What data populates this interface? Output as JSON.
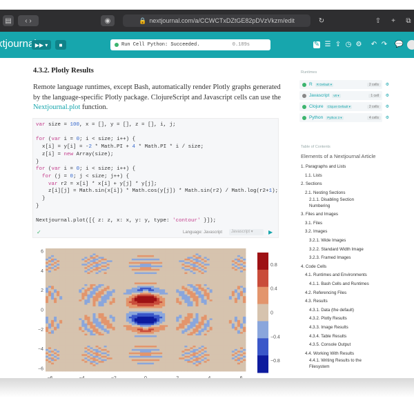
{
  "browser": {
    "url": "nextjournal.com/a/CCWCTxDZtGE82pDVzVkzm/edit",
    "lock_icon": "lock-icon"
  },
  "toolbar": {
    "logo": "xtjournal",
    "status_text": "Run Cell Python: Succeeded.",
    "status_time": "0.189s",
    "accent": "#17a6ad"
  },
  "article": {
    "heading": "4.3.2. Plotly Results",
    "para_before": "Remote language runtimes, except Bash, automatically render Plotly graphs generated by the language-specific Plotly package. ClojureScript and Javascript cells can use the ",
    "para_link": "Nextjournal.plot",
    "para_after": " function."
  },
  "code": {
    "lines": [
      "var size = 100, x = [], y = [], z = [], i, j;",
      "",
      "for (var i = 0; i < size; i++) {",
      "  x[i] = y[i] = -2 * Math.PI + 4 * Math.PI * i / size;",
      "  z[i] = new Array(size);",
      "}",
      "for (var i = 0; i < size; i++) {",
      "  for (j = 0; j < size; j++) {",
      "    var r2 = x[i] * x[i] + y[j] * y[j];",
      "    z[i][j] = Math.sin(x[i]) * Math.cos(y[j]) * Math.sin(r2) / Math.log(r2+1);",
      "  }",
      "}",
      "",
      "Nextjournal.plot([{ z: z, x: x, y: y, type: 'contour' }]);"
    ],
    "language_label": "Language: Javascript",
    "language_select": "Javascript"
  },
  "chart_data": {
    "type": "heatmap",
    "subtype": "contour",
    "x_ticks": [
      "−6",
      "−4",
      "−2",
      "0",
      "2",
      "4",
      "6"
    ],
    "y_ticks": [
      "6",
      "4",
      "2",
      "0",
      "−2",
      "−4",
      "−6"
    ],
    "xlim": [
      -6.28,
      6.28
    ],
    "ylim": [
      -6.28,
      6.28
    ],
    "colorbar_ticks": [
      "0.8",
      "0.4",
      "0",
      "−0.4",
      "−0.8"
    ],
    "colorscale": [
      "#0d1b9e",
      "#3a57c9",
      "#8aa6dc",
      "#d6c3ae",
      "#e3956c",
      "#c94c3a",
      "#9e1114"
    ],
    "formula": "sin(x)*cos(y)*sin(x^2+y^2)/log(x^2+y^2+1)"
  },
  "sidebar": {
    "runtimes_label": "Runtimes",
    "runtimes": [
      {
        "name": "R",
        "tag": "R Default",
        "cells": "2 cells",
        "color": "#3cb46e"
      },
      {
        "name": "Javascript",
        "tag": "v8",
        "cells": "1 cell",
        "color": "#888888"
      },
      {
        "name": "Clojure",
        "tag": "Clojure Default",
        "cells": "2 cells",
        "color": "#3cb46e"
      },
      {
        "name": "Python",
        "tag": "Python 3",
        "cells": "4 cells",
        "color": "#3cb46e"
      }
    ],
    "toc_label": "Table of Contents",
    "toc_title": "Elements of a Nextjournal Article",
    "toc": [
      {
        "label": "1. Paragraphs and Lists",
        "indent": 0
      },
      {
        "label": "1.1. Lists",
        "indent": 1
      },
      {
        "label": "2. Sections",
        "indent": 0
      },
      {
        "label": "2.1. Nesting Sections",
        "indent": 1
      },
      {
        "label": "2.1.1. Disabling Section Numbering",
        "indent": 2
      },
      {
        "label": "3. Files and Images",
        "indent": 0
      },
      {
        "label": "3.1. Files",
        "indent": 1
      },
      {
        "label": "3.2. Images",
        "indent": 1
      },
      {
        "label": "3.2.1. Wide Images",
        "indent": 2
      },
      {
        "label": "3.2.2. Standard Width Image",
        "indent": 2
      },
      {
        "label": "3.2.3. Framed Images",
        "indent": 2
      },
      {
        "label": "4. Code Cells",
        "indent": 0
      },
      {
        "label": "4.1. Runtimes and Environments",
        "indent": 1
      },
      {
        "label": "4.1.1. Bash Cells and Runtimes",
        "indent": 2
      },
      {
        "label": "4.2. Referencing Files",
        "indent": 1
      },
      {
        "label": "4.3. Results",
        "indent": 1
      },
      {
        "label": "4.3.1. Data (the default)",
        "indent": 2
      },
      {
        "label": "4.3.2. Plotly Results",
        "indent": 2
      },
      {
        "label": "4.3.3. Image Results",
        "indent": 2
      },
      {
        "label": "4.3.4. Table Results",
        "indent": 2
      },
      {
        "label": "4.3.5. Console Output",
        "indent": 2
      },
      {
        "label": "4.4. Working With Results",
        "indent": 1
      },
      {
        "label": "4.4.1. Writing Results to the Filesystem",
        "indent": 2
      }
    ]
  }
}
